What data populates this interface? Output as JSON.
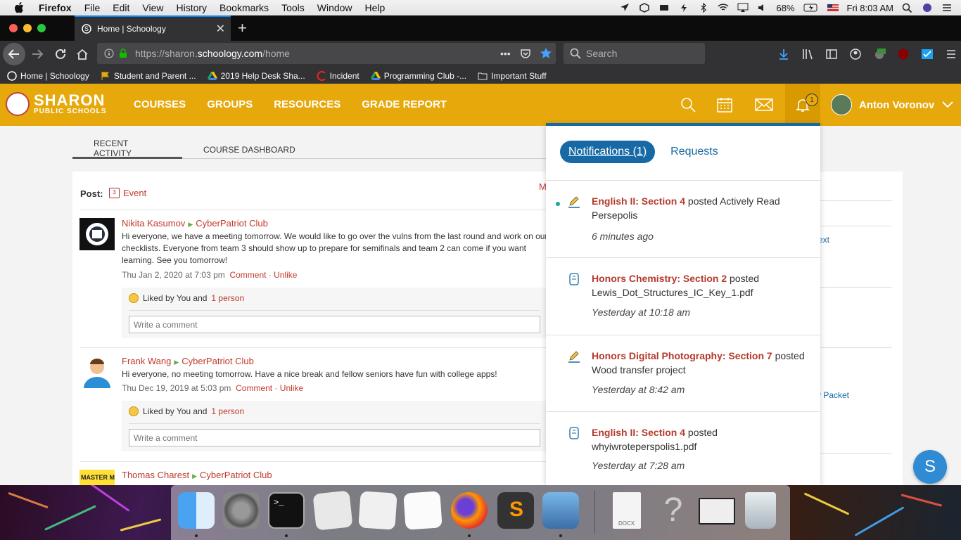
{
  "menubar": {
    "app": "Firefox",
    "items": [
      "File",
      "Edit",
      "View",
      "History",
      "Bookmarks",
      "Tools",
      "Window",
      "Help"
    ],
    "battery": "68%",
    "clock": "Fri 8:03 AM"
  },
  "browser": {
    "tab_title": "Home | Schoology",
    "url_prefix": "https://sharon.",
    "url_domain": "schoology.com",
    "url_path": "/home",
    "search_placeholder": "Search",
    "bookmarks": [
      "Home | Schoology",
      "Student and Parent ...",
      "2019 Help Desk Sha...",
      "Incident",
      "Programming Club -...",
      "Important Stuff"
    ]
  },
  "header": {
    "logo_line1": "SHARON",
    "logo_line2": "PUBLIC SCHOOLS",
    "nav": [
      "COURSES",
      "GROUPS",
      "RESOURCES",
      "GRADE REPORT"
    ],
    "bell_count": "1",
    "user_name": "Anton Voronov"
  },
  "subtabs": [
    "RECENT ACTIVITY",
    "COURSE DASHBOARD"
  ],
  "feed": {
    "post_label": "Post:",
    "event_label": "Event",
    "stray_letter": "M",
    "posts": [
      {
        "author": "Nikita Kasumov",
        "group": "CyberPatriot Club",
        "body": "Hi everyone, we have a meeting tomorrow. We would like to go over the vulns from the last round and work on our checklists. Everyone from team 3 should show up to prepare for semifinals and team 2 can come if you want learning. See you tomorrow!",
        "date": "Thu Jan 2, 2020 at 7:03 pm",
        "comment": "Comment",
        "unlike": "Unlike",
        "liked_prefix": "Liked by You and",
        "liked_link": "1 person",
        "comment_placeholder": "Write a comment"
      },
      {
        "author": "Frank Wang",
        "group": "CyberPatriot Club",
        "body": "Hi everyone, no meeting tomorrow. Have a nice break and fellow seniors have fun with college apps!",
        "date": "Thu Dec 19, 2019 at 5:03 pm",
        "comment": "Comment",
        "unlike": "Unlike",
        "liked_prefix": "Liked by You and",
        "liked_link": "1 person",
        "comment_placeholder": "Write a comment"
      },
      {
        "author": "Thomas Charest",
        "group": "CyberPatriot Club"
      }
    ]
  },
  "rightcol": {
    "link1": "ext",
    "link2": "v Packet"
  },
  "notifications": {
    "tab_active": "Notifications (1)",
    "tab_other": "Requests",
    "items": [
      {
        "course": "English II: Section 4",
        "action": "posted Actively Read Persepolis",
        "time": "6 minutes ago",
        "icon": "pencil-icon",
        "unread": true
      },
      {
        "course": "Honors Chemistry: Section 2",
        "action": "posted Lewis_Dot_Structures_IC_Key_1.pdf",
        "time": "Yesterday at 10:18 am",
        "icon": "file-icon",
        "unread": false
      },
      {
        "course": "Honors Digital Photography: Section 7",
        "action": "posted Wood transfer project",
        "time": "Yesterday at 8:42 am",
        "icon": "pencil-icon",
        "unread": false
      },
      {
        "course": "English II: Section 4",
        "action": "posted whyiwroteperspolis1.pdf",
        "time": "Yesterday at 7:28 am",
        "icon": "file-icon",
        "unread": false
      }
    ]
  },
  "fab_letter": "S",
  "dock_extra_label": "DOCX"
}
